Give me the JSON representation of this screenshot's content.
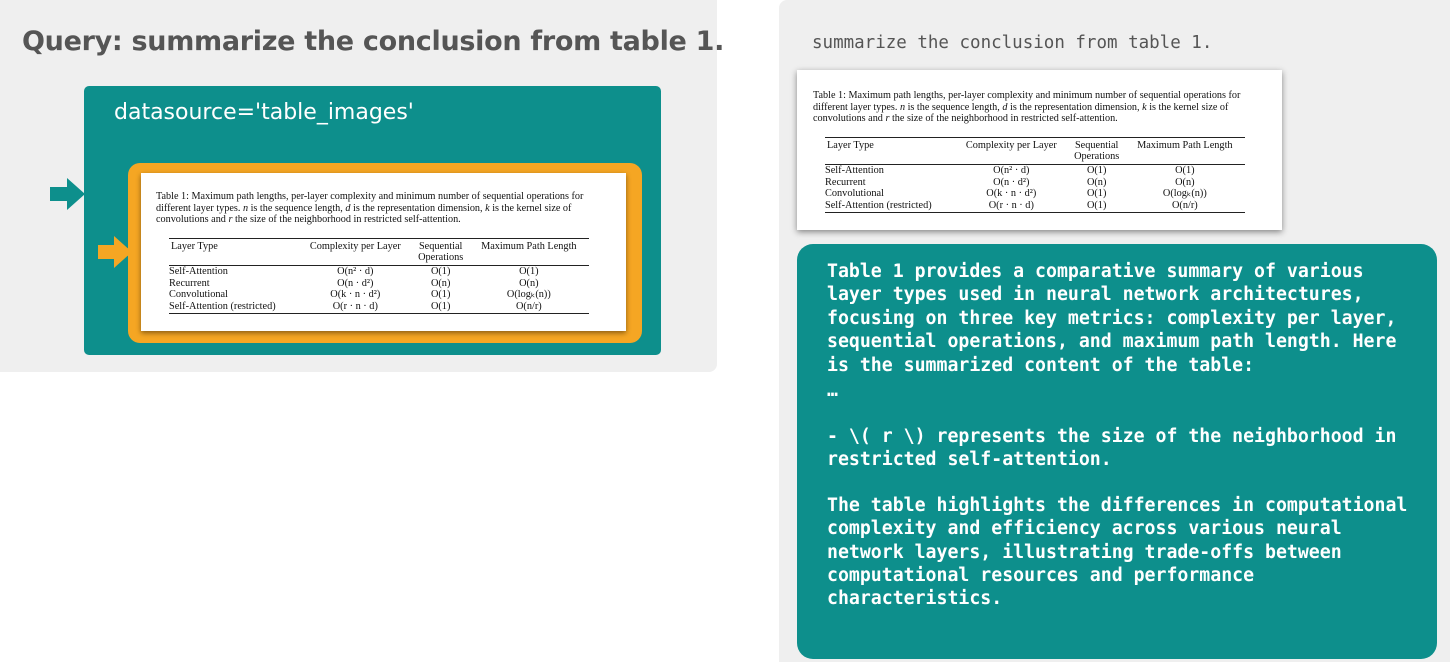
{
  "left": {
    "title": "Query: summarize the conclusion from table 1.",
    "datasource_label": "datasource='table_images'"
  },
  "table": {
    "caption_prefix": "Table 1:  Maximum path lengths, per-layer complexity and minimum number of sequential operations for different layer types. ",
    "caption_n": "n",
    "caption_mid1": " is the sequence length, ",
    "caption_d": "d",
    "caption_mid2": " is the representation dimension, ",
    "caption_k": "k",
    "caption_mid3": " is the kernel size of convolutions and ",
    "caption_r": "r",
    "caption_end": " the size of the neighborhood in restricted self-attention.",
    "headers": [
      "Layer Type",
      "Complexity per Layer",
      "Sequential Operations",
      "Maximum Path Length"
    ],
    "rows": [
      [
        "Self-Attention",
        "O(n² · d)",
        "O(1)",
        "O(1)"
      ],
      [
        "Recurrent",
        "O(n · d²)",
        "O(n)",
        "O(n)"
      ],
      [
        "Convolutional",
        "O(k · n · d²)",
        "O(1)",
        "O(logₖ(n))"
      ],
      [
        "Self-Attention (restricted)",
        "O(r · n · d)",
        "O(1)",
        "O(n/r)"
      ]
    ],
    "rows_right_panel": [
      [
        "Self-Attention",
        "O(n² · d)",
        "O(1)",
        "O(1)"
      ],
      [
        "Recurrent",
        "O(n · d²)",
        "O(n)",
        "O(n)"
      ],
      [
        "Convolutional",
        "O(k · n · d²)",
        "O(1)",
        "O(logₖ(n))"
      ],
      [
        "Self-Attention (restricted)",
        "O(r · n · d)",
        "O(1)",
        "O(n/r)"
      ]
    ]
  },
  "right": {
    "query": "summarize the conclusion from table 1.",
    "answer_p1": "Table 1 provides a comparative summary of various layer types used in neural network architectures, focusing on three key metrics: complexity per layer, sequential operations, and maximum path length. Here is the summarized content of the table:",
    "answer_ellipsis": "…",
    "answer_p2": "- \\( r \\) represents the size of the neighborhood in restricted self-attention.",
    "answer_p3": "The table highlights the differences in computational complexity and efficiency across various neural network layers, illustrating trade-offs between computational resources and performance characteristics."
  },
  "colors": {
    "teal": "#0d8f8c",
    "orange": "#f5a623",
    "panel_bg": "#efefef",
    "title_gray": "#555555"
  },
  "icons": [
    "right-arrow-icon",
    "right-arrow-icon"
  ]
}
